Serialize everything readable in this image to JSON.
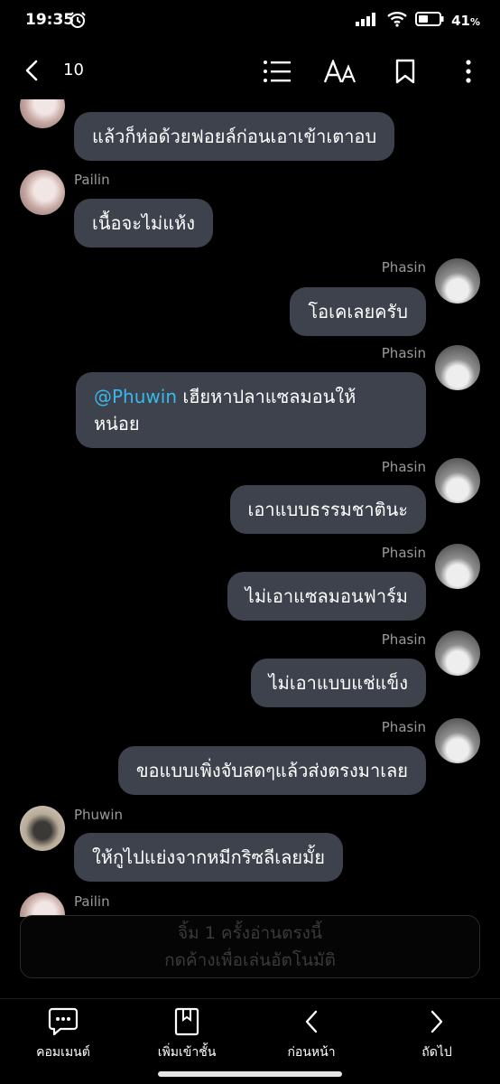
{
  "status": {
    "time": "19:35",
    "battery": "41",
    "battery_unit": "%"
  },
  "topnav": {
    "count": "10"
  },
  "chat": {
    "partial_message": "แล้วก็ห่อด้วยฟอยล์ก่อนเอาเข้าเตาอบ",
    "messages": [
      {
        "sender": "Pailin",
        "text": "เนื้อจะไม่แห้ง"
      },
      {
        "sender": "Phasin",
        "text": "โอเคเลยครับ"
      },
      {
        "sender": "Phasin",
        "mention": "@Phuwin",
        "text": " เฮียหาปลาแซลมอนให้",
        "text2": "หน่อย"
      },
      {
        "sender": "Phasin",
        "text": "เอาแบบธรรมชาตินะ"
      },
      {
        "sender": "Phasin",
        "text": "ไม่เอาแซลมอนฟาร์ม"
      },
      {
        "sender": "Phasin",
        "text": "ไม่เอาแบบแช่แข็ง"
      },
      {
        "sender": "Phasin",
        "text": "ขอแบบเพิ่งจับสดๆแล้วส่งตรงมาเลย"
      },
      {
        "sender": "Phuwin",
        "text": "ให้กูไปแย่งจากหมีกริซลีเลยมั้ย"
      },
      {
        "sender": "Pailin"
      }
    ]
  },
  "autoplay": {
    "line1": "จิ้ม 1 ครั้งอ่านตรงนี้",
    "line2": "กดค้างเพื่อเล่นอัตโนมัติ"
  },
  "bottomnav": {
    "comment": "คอมเมนต์",
    "add_shelf": "เพิ่มเข้าชั้น",
    "prev": "ก่อนหน้า",
    "next": "ถัดไป"
  }
}
